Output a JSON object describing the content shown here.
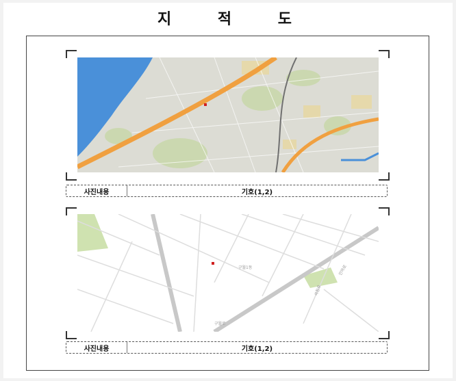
{
  "document": {
    "title": "지 적 도"
  },
  "photos": [
    {
      "type": "aerial-map",
      "caption_label": "사진내용",
      "caption_value": "기호(1,2)"
    },
    {
      "type": "street-map",
      "caption_label": "사진내용",
      "caption_value": "기호(1,2)",
      "street_labels": [
        "구월1동",
        "석정로",
        "구월로",
        "인하로"
      ]
    }
  ],
  "colors": {
    "water": "#4a90d9",
    "highway": "#f0a040",
    "land": "#dcdcd4",
    "park": "#cfe2b0",
    "street_bg": "#ffffff",
    "marker": "#d02020"
  }
}
